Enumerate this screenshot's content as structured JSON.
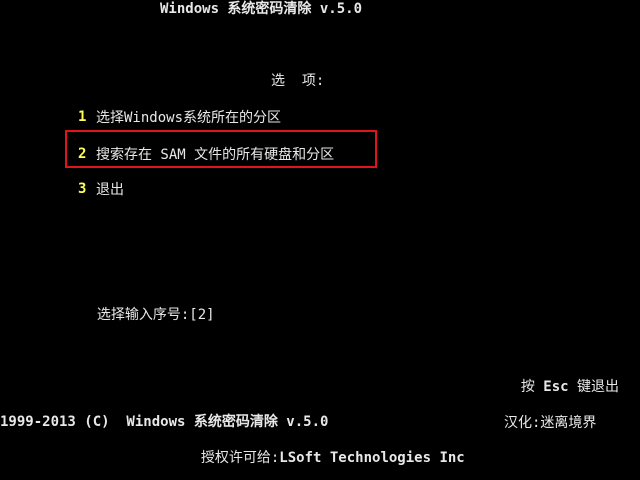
{
  "header": {
    "title": "Windows 系统密码清除 v.5.0"
  },
  "menu": {
    "heading": "选  项:",
    "items": [
      {
        "number": "1",
        "label": "选择Windows系统所在的分区"
      },
      {
        "number": "2",
        "label": "搜索存在 SAM 文件的所有硬盘和分区"
      },
      {
        "number": "3",
        "label": "退出"
      }
    ]
  },
  "prompt": {
    "label": "选择输入序号:",
    "value": "[2]"
  },
  "esc_hint": {
    "prefix": "按",
    "key": "Esc",
    "suffix": "键退出"
  },
  "footer": {
    "copyright": "1999-2013 (C)  Windows 系统密码清除 v.5.0",
    "license_label": "授权许可给:",
    "license_value": "LSoft Technologies Inc",
    "localization": "汉化:迷离境界"
  },
  "colors": {
    "background": "#000000",
    "text": "#e8e8e8",
    "menu_number": "#ffff55",
    "highlight_border": "#e0141c"
  }
}
